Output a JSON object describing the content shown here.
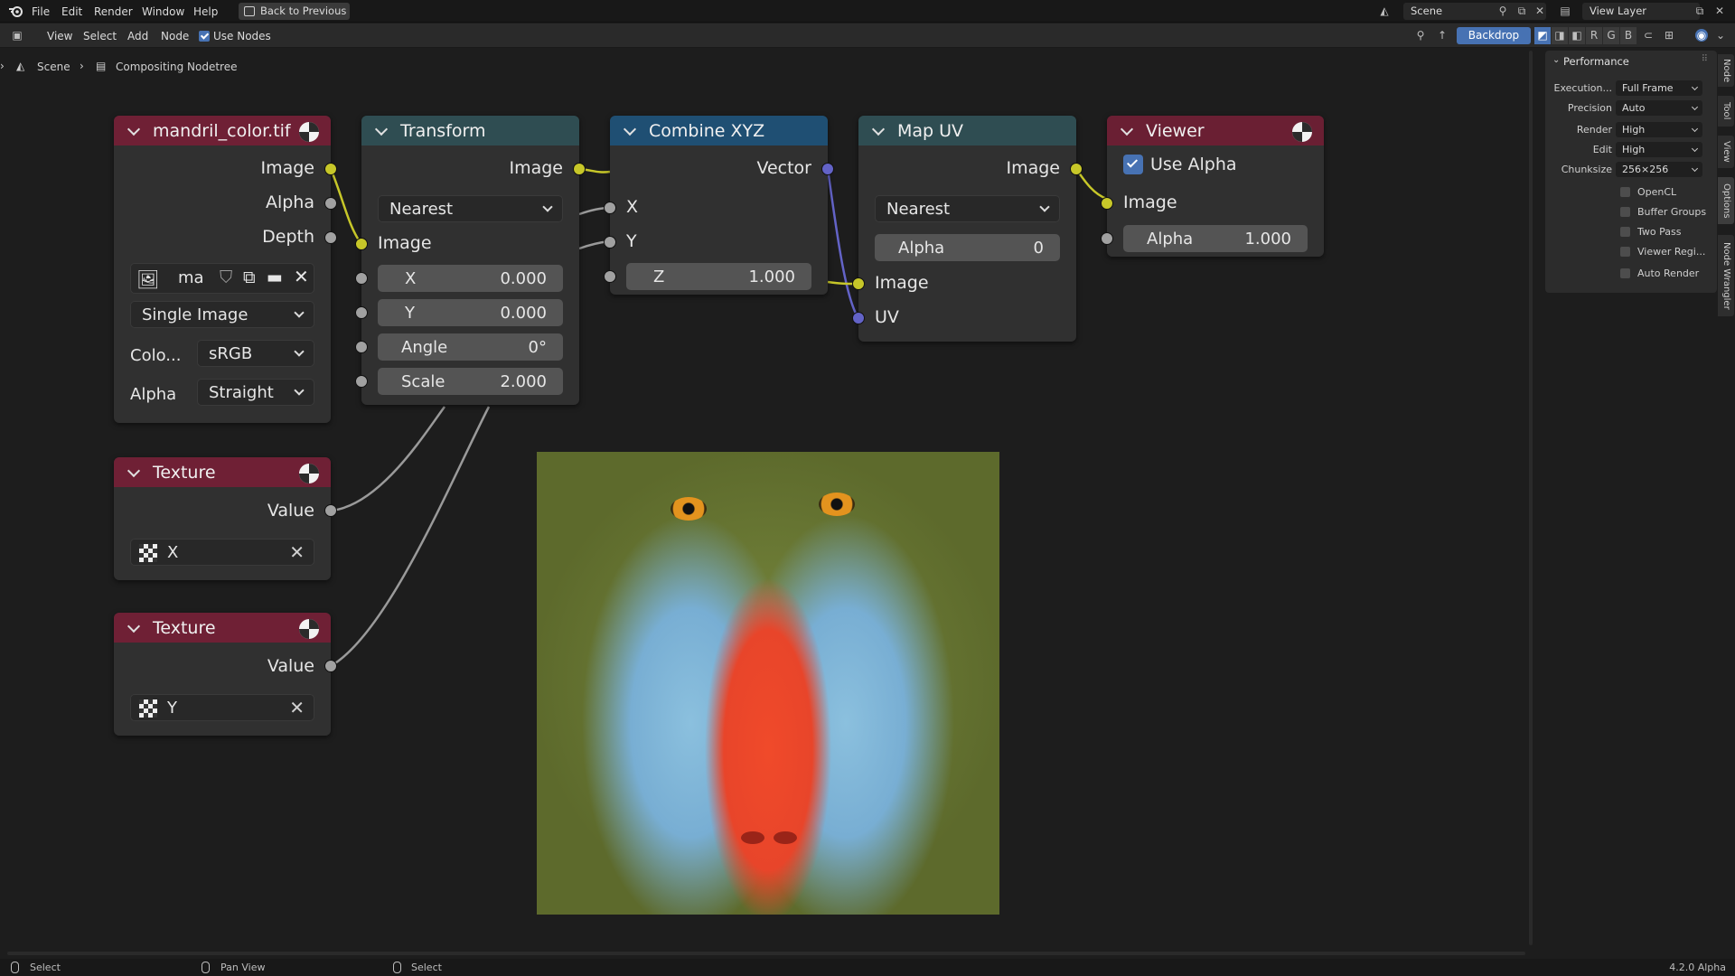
{
  "menu": {
    "items": [
      "File",
      "Edit",
      "Render",
      "Window",
      "Help"
    ],
    "back_button": "Back to Previous",
    "scene_field": "Scene",
    "view_layer_field": "View Layer"
  },
  "editor_header": {
    "view": "View",
    "select": "Select",
    "add": "Add",
    "node": "Node",
    "use_nodes": "Use Nodes",
    "use_nodes_checked": true,
    "backdrop": "Backdrop",
    "channels": [
      "R",
      "G",
      "B"
    ]
  },
  "breadcrumb": {
    "scene": "Scene",
    "tree": "Compositing Nodetree"
  },
  "nodes": {
    "image": {
      "title": "mandril_color.tif",
      "outputs": [
        "Image",
        "Alpha",
        "Depth"
      ],
      "image_name": "ma",
      "source": "Single Image",
      "color_label": "Colo...",
      "color_value": "sRGB",
      "alpha_label": "Alpha",
      "alpha_value": "Straight"
    },
    "transform": {
      "title": "Transform",
      "output": "Image",
      "filter": "Nearest",
      "input": "Image",
      "x_label": "X",
      "x_value": "0.000",
      "y_label": "Y",
      "y_value": "0.000",
      "angle_label": "Angle",
      "angle_value": "0°",
      "scale_label": "Scale",
      "scale_value": "2.000"
    },
    "combine": {
      "title": "Combine XYZ",
      "output": "Vector",
      "x": "X",
      "y": "Y",
      "z_label": "Z",
      "z_value": "1.000"
    },
    "mapuv": {
      "title": "Map UV",
      "output": "Image",
      "filter": "Nearest",
      "alpha_label": "Alpha",
      "alpha_value": "0",
      "input_image": "Image",
      "input_uv": "UV"
    },
    "viewer": {
      "title": "Viewer",
      "use_alpha": "Use Alpha",
      "use_alpha_checked": true,
      "input_image": "Image",
      "alpha_label": "Alpha",
      "alpha_value": "1.000"
    },
    "texture_x": {
      "title": "Texture",
      "output": "Value",
      "texture": "X"
    },
    "texture_y": {
      "title": "Texture",
      "output": "Value",
      "texture": "Y"
    }
  },
  "sidebar": {
    "panel_title": "Performance",
    "rows": [
      {
        "label": "Execution...",
        "value": "Full Frame"
      },
      {
        "label": "Precision",
        "value": "Auto"
      },
      {
        "label": "Render",
        "value": "High"
      },
      {
        "label": "Edit",
        "value": "High"
      },
      {
        "label": "Chunksize",
        "value": "256×256"
      }
    ],
    "checks": [
      "OpenCL",
      "Buffer Groups",
      "Two Pass",
      "Viewer Regi...",
      "Auto Render"
    ],
    "tabs": [
      "Node",
      "Tool",
      "View",
      "Options",
      "Node Wrangler"
    ]
  },
  "status": {
    "left": "Select",
    "middle": "Pan View",
    "right": "Select",
    "version": "4.2.0 Alpha"
  },
  "colors": {
    "accent": "#4772b3",
    "socket_color": "#c7c729",
    "socket_vector": "#6363c7",
    "socket_value": "#a1a1a1"
  }
}
